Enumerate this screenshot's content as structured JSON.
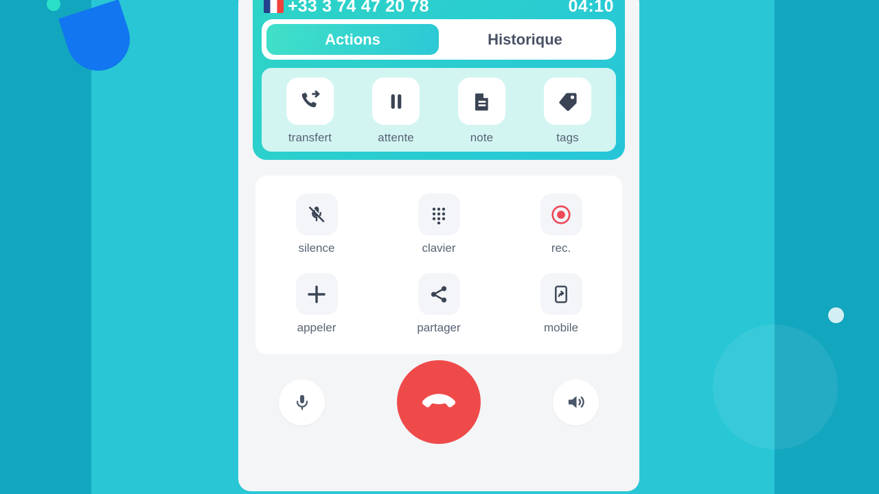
{
  "call": {
    "country_flag": "france-flag",
    "phone_number": "+33 3 74 47 20 78",
    "timer": "04:10"
  },
  "tabs": [
    {
      "label": "Actions",
      "active": true
    },
    {
      "label": "Historique",
      "active": false
    }
  ],
  "quick_actions": [
    {
      "label": "transfert",
      "icon": "call-forward-icon"
    },
    {
      "label": "attente",
      "icon": "pause-icon"
    },
    {
      "label": "note",
      "icon": "document-icon"
    },
    {
      "label": "tags",
      "icon": "tag-icon"
    }
  ],
  "controls": [
    {
      "label": "silence",
      "icon": "mic-off-icon"
    },
    {
      "label": "clavier",
      "icon": "dialpad-icon"
    },
    {
      "label": "rec.",
      "icon": "record-icon"
    },
    {
      "label": "appeler",
      "icon": "plus-icon"
    },
    {
      "label": "partager",
      "icon": "share-icon"
    },
    {
      "label": "mobile",
      "icon": "mobile-forward-icon"
    }
  ],
  "bottom_bar": {
    "mic_label": "microphone",
    "hangup_label": "raccrocher",
    "speaker_label": "haut-parleur"
  },
  "colors": {
    "background_teal": "#29C6D6",
    "background_teal_dark": "#13A6BF",
    "header_gradient_start": "#2ED4C6",
    "header_gradient_end": "#26C6D9",
    "active_tab_start": "#40E0C8",
    "active_tab_end": "#2CC8D6",
    "quick_actions_bg": "#D2F5F2",
    "panel_bg": "#F4F5F7",
    "icon_dark": "#3A4454",
    "label_gray": "#586274",
    "record_red": "#EF4A5A",
    "hangup_red": "#EF4A4A",
    "deco_blue": "#1276F0"
  }
}
